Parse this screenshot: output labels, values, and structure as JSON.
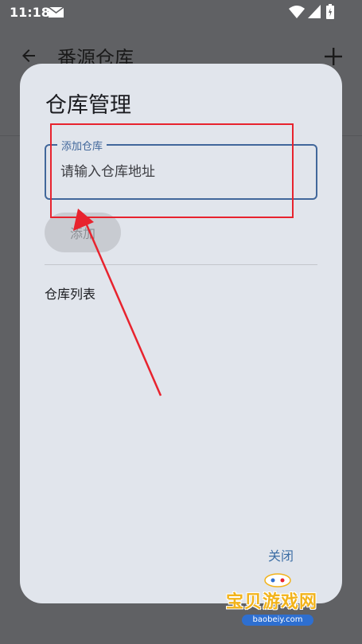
{
  "status_bar": {
    "time": "11:18",
    "icons": [
      "mail-icon",
      "wifi-icon",
      "signal-icon",
      "battery-icon"
    ]
  },
  "background_app": {
    "title": "番源仓库",
    "back_icon": "back-arrow-icon",
    "add_icon": "plus-icon"
  },
  "dialog": {
    "title": "仓库管理",
    "field_label": "添加仓库",
    "field_placeholder": "请输入仓库地址",
    "field_value": "",
    "add_button_label": "添加",
    "list_label": "仓库列表",
    "close_button_label": "关闭"
  },
  "annotation": {
    "color": "#e8232e"
  },
  "watermark": {
    "text": "宝贝游戏网",
    "url": "baobeiy.com"
  },
  "colors": {
    "scrim": "#606164",
    "dialog_bg": "#e1e5ec",
    "accent": "#41679b",
    "close_text": "#3d6ea5"
  }
}
